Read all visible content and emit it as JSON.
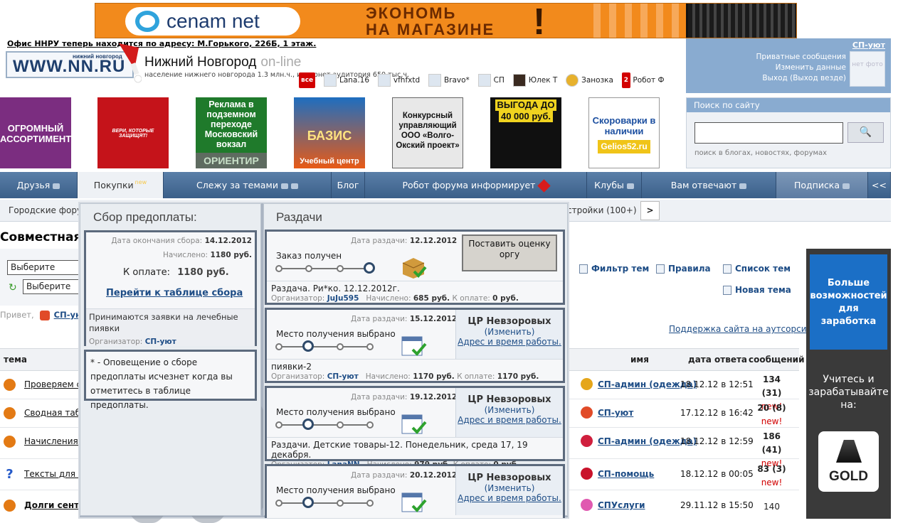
{
  "banner": {
    "brand": "cenam net",
    "slogan_line1": "ЭКОНОМЬ",
    "slogan_line2": "НА МАГАЗИНЕ",
    "excl": "!"
  },
  "header": {
    "office_notice": "Офис ННРУ теперь находится по адресу: М.Горького, 226Б, 1 этаж.",
    "logo": "WWW.NN.RU",
    "logo_small": "нижний новгород",
    "city": "Нижний Новгород",
    "online": "on-line",
    "population": "население нижнего новгорода 1.3 млн.ч., интернет аудитория 650 тыс.ч."
  },
  "users": {
    "all_label": "все",
    "list": [
      "Lana.16",
      "vfhfxtd",
      "Bravo*",
      "СП",
      "Юлек Т",
      "Занозка",
      "Робот Ф"
    ],
    "badge": "2"
  },
  "user_panel": {
    "name": "СП-уют",
    "links": [
      "Приватные сообщения",
      "Изменить данные",
      "Выход",
      "(Выход везде)"
    ],
    "photo": "нет фото"
  },
  "ads": {
    "a1": "ОГРОМНЫЙ АССОРТИМЕНТ",
    "a2": "ВЕРИ, КОТОРЫЕ ЗАЩИЩЯТ!",
    "a3": "Реклама в подземном переходе Московский вокзал",
    "a3b": "ОРИЕНТИР",
    "a4": "БАЗИС",
    "a4b": "Учебный центр",
    "a5": "Конкурсный управляющий ООО «Волго-Окский проект»",
    "a6a": "ВЫГОДА ДО",
    "a6b": "40 000 руб.",
    "a7": "Скороварки в наличии",
    "a7b": "Gelios52.ru"
  },
  "search": {
    "title": "Поиск по сайту",
    "button": "🔍",
    "hint": "поиск в блогах, новостях, форумах"
  },
  "nav": {
    "items": [
      "Друзья",
      "Покупки",
      "Слежу за темами",
      "Блог",
      "Робот форума информирует",
      "Клубы",
      "Вам отвечают",
      "Подписка",
      "<<"
    ],
    "new_label": "new"
  },
  "subnav": {
    "left": "Городские фору",
    "right": "стройки (100+)",
    "arrow": ">"
  },
  "page": {
    "title": "Совместная п",
    "select1": "Выберите форум",
    "select2": "Выберите те",
    "hello": "Привет,",
    "hello_name": "СП-уют"
  },
  "right_links": {
    "filter": "Фильтр тем",
    "rules": "Правила",
    "list": "Список тем",
    "new_topic": "Новая тема",
    "support": "Поддержка сайта на аутсорсинг"
  },
  "table": {
    "headers": {
      "topic": "тема",
      "name": "имя",
      "date": "дата ответа",
      "msgs": "сообщений"
    },
    "rows": [
      {
        "topic": "Проверяем с",
        "name": "СП-админ (одежда)",
        "date": "18.12.12 в 12:51",
        "count": "134 (31)",
        "new": "new!"
      },
      {
        "topic": "Сводная табл",
        "name": "СП-уют",
        "date": "17.12.12 в 16:42",
        "count": "20 (8)",
        "new": "new!"
      },
      {
        "topic": "Начисления з",
        "name": "СП-админ (одежда)",
        "date": "18.12.12 в 12:59",
        "count": "186 (41)",
        "new": "new!"
      },
      {
        "topic": "Тексты для м",
        "name": "СП-помощь",
        "date": "18.12.12 в 00:05",
        "count": "83 (3)",
        "new": "new!"
      },
      {
        "topic": "Долги сентяб",
        "name": "СПУслуги",
        "date": "29.11.12 в 15:50",
        "count": "140",
        "new": ""
      }
    ]
  },
  "promo": {
    "blue": "Больше возможностей для заработка",
    "text": "Учитесь и зарабатывайте на:",
    "gold": "GOLD"
  },
  "prepay": {
    "title": "Сбор предоплаты:",
    "end_label": "Дата окончания сбора:",
    "end_date": "14.12.2012",
    "charged_label": "Начислено:",
    "charged": "1180 руб.",
    "pay_label": "К оплате:",
    "pay": "1180 руб.",
    "link": "Перейти к таблице сбора",
    "note": "Принимаются заявки на лечебные пиявки",
    "org_label": "Организатор:",
    "org": "СП-уют",
    "footnote": "* - Оповещение о сборе предоплаты исчезнет когда вы отметитесь в таблице предоплаты."
  },
  "distributions": {
    "title": "Раздачи",
    "date_label": "Дата раздачи:",
    "org_label": "Организатор:",
    "charged_label": "Начислено:",
    "pay_label": "К оплате:",
    "change": "Изменить",
    "address": "Адрес и время работы.",
    "rate_button": "Поставить оценку оргу",
    "cards": [
      {
        "date": "12.12.2012",
        "status": "Заказ получен",
        "note": "Раздача. Ри*ко. 12.12.2012г.",
        "org": "JuJu595",
        "charged": "685 руб.",
        "pay": "0 руб.",
        "point": ""
      },
      {
        "date": "15.12.2012",
        "status": "Место получения выбрано",
        "note": "пиявки-2",
        "org": "СП-уют",
        "charged": "1170 руб.",
        "pay": "1170 руб.",
        "point": "ЦР Невзоровых"
      },
      {
        "date": "19.12.2012",
        "status": "Место получения выбрано",
        "note": "Раздачи. Детские товары-12. Понедельник, среда 17, 19 декабря.",
        "org": "LanaNN",
        "charged": "979 руб.",
        "pay": "0 руб.",
        "point": "ЦР Невзоровых"
      },
      {
        "date": "20.12.2012",
        "status": "Место получения выбрано",
        "note": "",
        "org": "",
        "charged": "",
        "pay": "",
        "point": "ЦР Невзоровых"
      }
    ]
  }
}
